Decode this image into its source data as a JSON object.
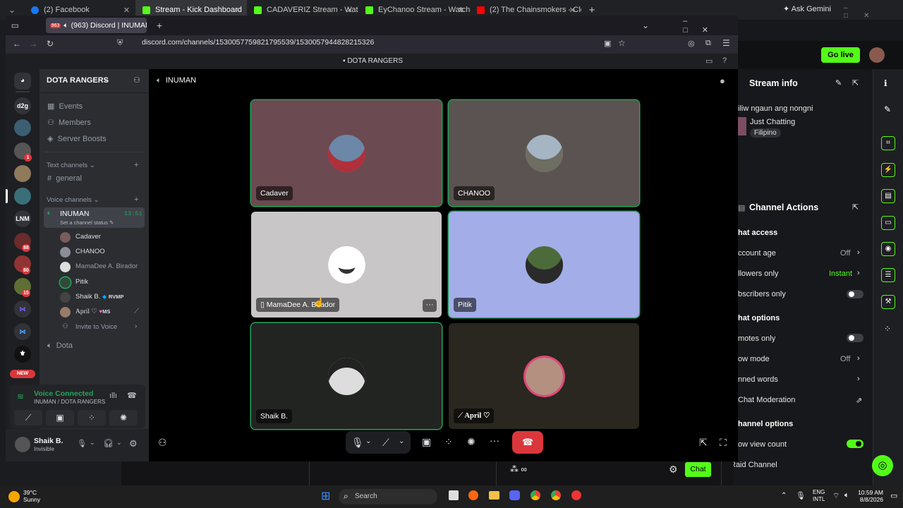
{
  "outer_tabs": [
    {
      "label": "(2) Facebook",
      "color": "#1877f2"
    },
    {
      "label": "Stream - Kick Dashboard",
      "color": "#53fc18"
    },
    {
      "label": "CADAVERIZ Stream - Watch Liv",
      "color": "#53fc18"
    },
    {
      "label": "EyChanoo Stream - Watch Live",
      "color": "#53fc18"
    },
    {
      "label": "(2) The Chainsmokers - Closer (",
      "color": "#ff0000"
    }
  ],
  "ask_gemini": "Ask Gemini",
  "discord_tab": {
    "badge": "963",
    "label": "(963) Discord | INUMAN | D"
  },
  "url": "discord.com/channels/1530057759821795539/1530057944828215326",
  "title_bar": "DOTA RANGERS",
  "servers": [
    {
      "label": "d2g"
    },
    {
      "label": "LNM"
    },
    {
      "label": "NEW"
    }
  ],
  "server_badges": [
    "1",
    "88",
    "80",
    "15"
  ],
  "server": {
    "name": "DOTA RANGERS"
  },
  "menu": [
    {
      "label": "Events"
    },
    {
      "label": "Members"
    },
    {
      "label": "Server Boosts"
    }
  ],
  "text_category": "Text channels",
  "text_channels": [
    "general"
  ],
  "voice_category": "Voice channels",
  "voice_channel": {
    "name": "INUMAN",
    "timer": "13:51",
    "status": "Set a channel status"
  },
  "voice_members": [
    {
      "name": "Cadaver"
    },
    {
      "name": "CHANOO"
    },
    {
      "name": "MamaDee A. Birador"
    },
    {
      "name": "Pitik"
    },
    {
      "name": "Shaik B.",
      "tag": "RVMP"
    },
    {
      "name": "April ♡",
      "tag": "MS"
    }
  ],
  "invite": "Invite to Voice",
  "other_voice": "Dota",
  "voice_connected": {
    "title": "Voice Connected",
    "sub": "INUMAN / DOTA RANGERS"
  },
  "user": {
    "name": "Shaik B.",
    "status": "Invisible"
  },
  "stage_header": "INUMAN",
  "tiles": [
    {
      "name": "Cadaver",
      "bg": "#6b4a51"
    },
    {
      "name": "CHANOO",
      "bg": "#5b5351"
    },
    {
      "name": "MamaDee A. Birador",
      "bg": "#c8c6c7"
    },
    {
      "name": "Pitik",
      "bg": "#a3ade8"
    },
    {
      "name": "Shaik B.",
      "bg": "#222422"
    },
    {
      "name": "April ♡",
      "bg": "#29271f"
    }
  ],
  "kick": {
    "go_live": "Go live",
    "stream_info": "Stream info",
    "title": "iliw ngaun ang nongni",
    "category": "Just Chatting",
    "language": "Filipino",
    "channel_actions": "Channel Actions",
    "chat_access": "hat access",
    "account_age": "ccount age",
    "account_age_val": "Off",
    "followers": "llowers only",
    "followers_val": "Instant",
    "subscribers": "bscribers only",
    "chat_options": "hat options",
    "emotes": "motes only",
    "slow": "ow mode",
    "slow_val": "Off",
    "banned": "nned words",
    "ai_mod": "Chat Moderation",
    "channel_options": "hannel options",
    "view_count": "ow view count",
    "raid": "Raid Channel",
    "chat_btn": "Chat"
  },
  "taskbar": {
    "temp": "39°C",
    "weather": "Sunny",
    "search": "Search",
    "lang": "ENG",
    "lang2": "INTL",
    "time": "10:59 AM",
    "date": "8/8/2026"
  }
}
